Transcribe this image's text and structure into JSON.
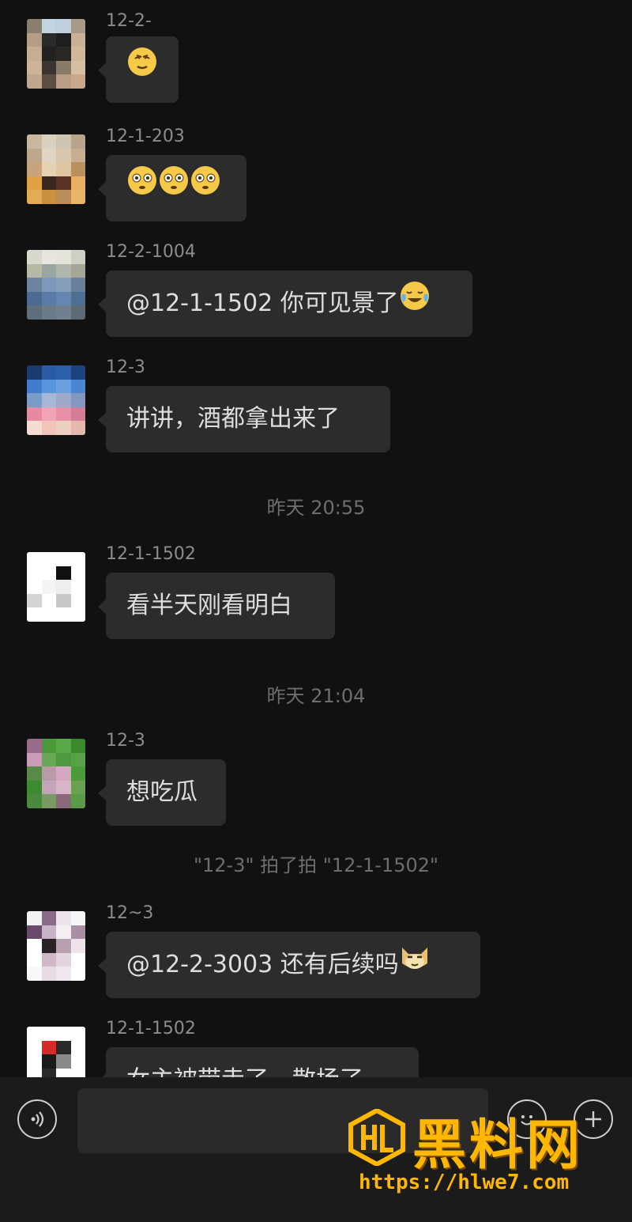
{
  "messages": [
    {
      "sender": "12-2-",
      "text": "",
      "emojis": [
        "😷"
      ]
    },
    {
      "sender": "12-1-203",
      "text": "",
      "emojis": [
        "😳",
        "😳",
        "😳"
      ]
    },
    {
      "sender": "12-2-1004",
      "text": "@12-1-1502 你可见景了",
      "emojis": [
        "😂"
      ]
    },
    {
      "sender": "12-3",
      "text": "讲讲，酒都拿出来了",
      "emojis": []
    },
    {
      "sender": "12-1-1502",
      "text": "看半天刚看明白",
      "emojis": []
    },
    {
      "sender": "12-3",
      "text": "想吃瓜",
      "emojis": []
    },
    {
      "sender": "12~3",
      "text": "@12-2-3003 还有后续吗",
      "emojis": [
        "🐱"
      ]
    },
    {
      "sender": "12-1-1502",
      "text": "女主被带走了，散场了",
      "emojis": []
    }
  ],
  "system": {
    "time1": "昨天 20:55",
    "time2": "昨天 21:04",
    "pat": "\"12-3\" 拍了拍 \"12-1-1502\""
  },
  "input": {
    "voice_icon": "voice-icon",
    "emoji_icon": "emoji-icon",
    "plus_icon": "plus-icon"
  },
  "watermark": {
    "title": "黑料网",
    "url": "https://hlwe7.com",
    "color": "#ffb700"
  }
}
